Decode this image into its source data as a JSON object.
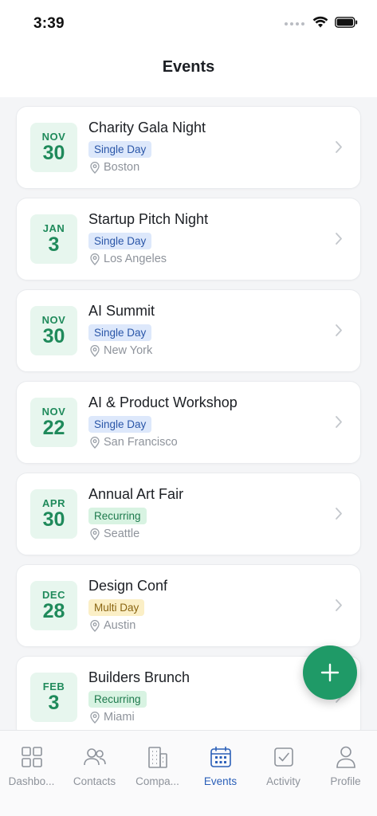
{
  "status_bar": {
    "time": "3:39"
  },
  "header": {
    "title": "Events"
  },
  "events": [
    {
      "month": "NOV",
      "day": "30",
      "title": "Charity Gala Night",
      "badge": "Single Day",
      "badge_type": "single",
      "location": "Boston"
    },
    {
      "month": "JAN",
      "day": "3",
      "title": "Startup Pitch Night",
      "badge": "Single Day",
      "badge_type": "single",
      "location": "Los Angeles"
    },
    {
      "month": "NOV",
      "day": "30",
      "title": "AI Summit",
      "badge": "Single Day",
      "badge_type": "single",
      "location": "New York"
    },
    {
      "month": "NOV",
      "day": "22",
      "title": "AI & Product Workshop",
      "badge": "Single Day",
      "badge_type": "single",
      "location": "San Francisco"
    },
    {
      "month": "APR",
      "day": "30",
      "title": "Annual Art Fair",
      "badge": "Recurring",
      "badge_type": "recurring",
      "location": "Seattle"
    },
    {
      "month": "DEC",
      "day": "28",
      "title": "Design Conf",
      "badge": "Multi Day",
      "badge_type": "multi",
      "location": "Austin"
    },
    {
      "month": "FEB",
      "day": "3",
      "title": "Builders Brunch",
      "badge": "Recurring",
      "badge_type": "recurring",
      "location": "Miami"
    }
  ],
  "fab": {
    "icon": "plus-icon",
    "color": "#1f9a67"
  },
  "tabs": [
    {
      "label": "Dashbo...",
      "icon": "dashboard-icon",
      "active": false
    },
    {
      "label": "Contacts",
      "icon": "contacts-icon",
      "active": false
    },
    {
      "label": "Compa...",
      "icon": "companies-icon",
      "active": false
    },
    {
      "label": "Events",
      "icon": "calendar-icon",
      "active": true
    },
    {
      "label": "Activity",
      "icon": "activity-icon",
      "active": false
    },
    {
      "label": "Profile",
      "icon": "profile-icon",
      "active": false
    }
  ],
  "colors": {
    "accent_green": "#1f8a5b",
    "active_tab": "#2a5fb8",
    "inactive_tab": "#8e939b"
  }
}
